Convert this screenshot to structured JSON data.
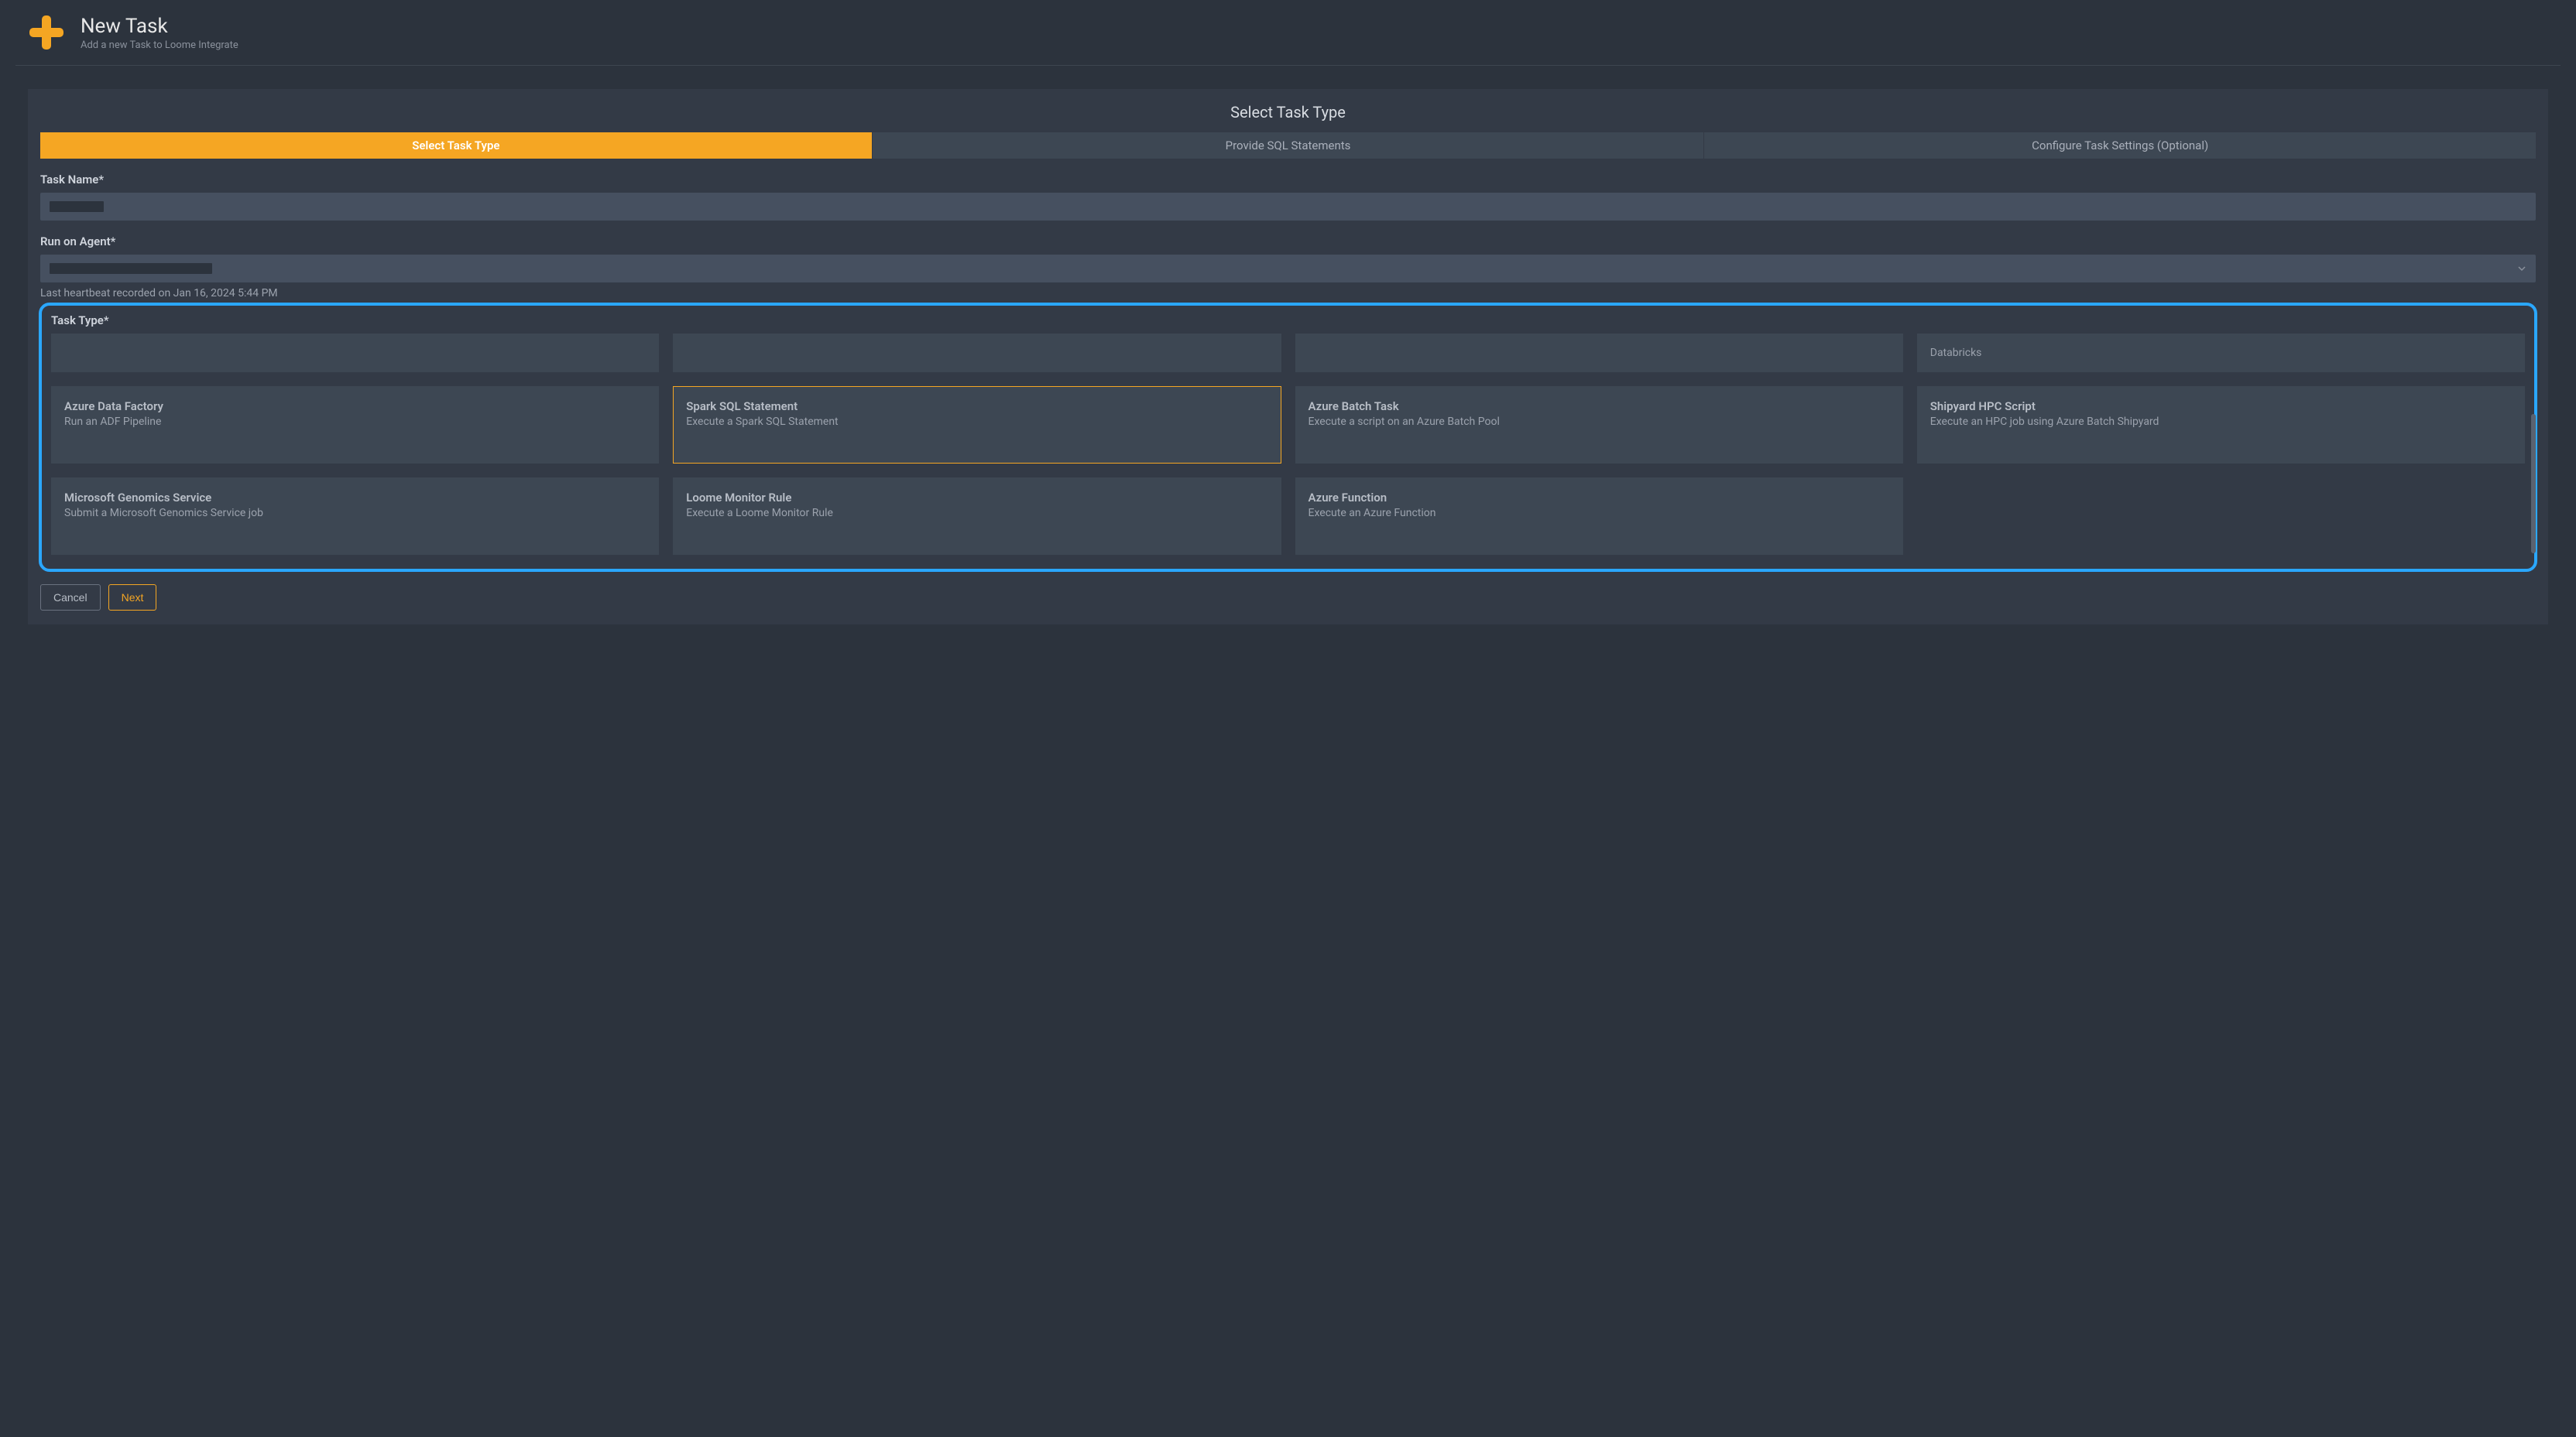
{
  "header": {
    "title": "New Task",
    "subtitle": "Add a new Task to Loome Integrate"
  },
  "panel": {
    "title": "Select Task Type"
  },
  "tabs": [
    {
      "label": "Select Task Type",
      "active": true
    },
    {
      "label": "Provide SQL Statements",
      "active": false
    },
    {
      "label": "Configure Task Settings (Optional)",
      "active": false
    }
  ],
  "form": {
    "taskName": {
      "label": "Task Name*",
      "value": ""
    },
    "runOnAgent": {
      "label": "Run on Agent*",
      "value": "",
      "helper": "Last heartbeat recorded on Jan 16, 2024 5:44 PM"
    },
    "taskType": {
      "label": "Task Type*"
    }
  },
  "taskTypesPartial": [
    {
      "desc": ""
    },
    {
      "desc": ""
    },
    {
      "desc": ""
    },
    {
      "desc": "Databricks"
    }
  ],
  "taskTypes": [
    {
      "title": "Azure Data Factory",
      "desc": "Run an ADF Pipeline",
      "selected": false
    },
    {
      "title": "Spark SQL Statement",
      "desc": "Execute a Spark SQL Statement",
      "selected": true
    },
    {
      "title": "Azure Batch Task",
      "desc": "Execute a script on an Azure Batch Pool",
      "selected": false
    },
    {
      "title": "Shipyard HPC Script",
      "desc": "Execute an HPC job using Azure Batch Shipyard",
      "selected": false
    },
    {
      "title": "Microsoft Genomics Service",
      "desc": "Submit a Microsoft Genomics Service job",
      "selected": false
    },
    {
      "title": "Loome Monitor Rule",
      "desc": "Execute a Loome Monitor Rule",
      "selected": false
    },
    {
      "title": "Azure Function",
      "desc": "Execute an Azure Function",
      "selected": false
    }
  ],
  "buttons": {
    "cancel": "Cancel",
    "next": "Next"
  }
}
